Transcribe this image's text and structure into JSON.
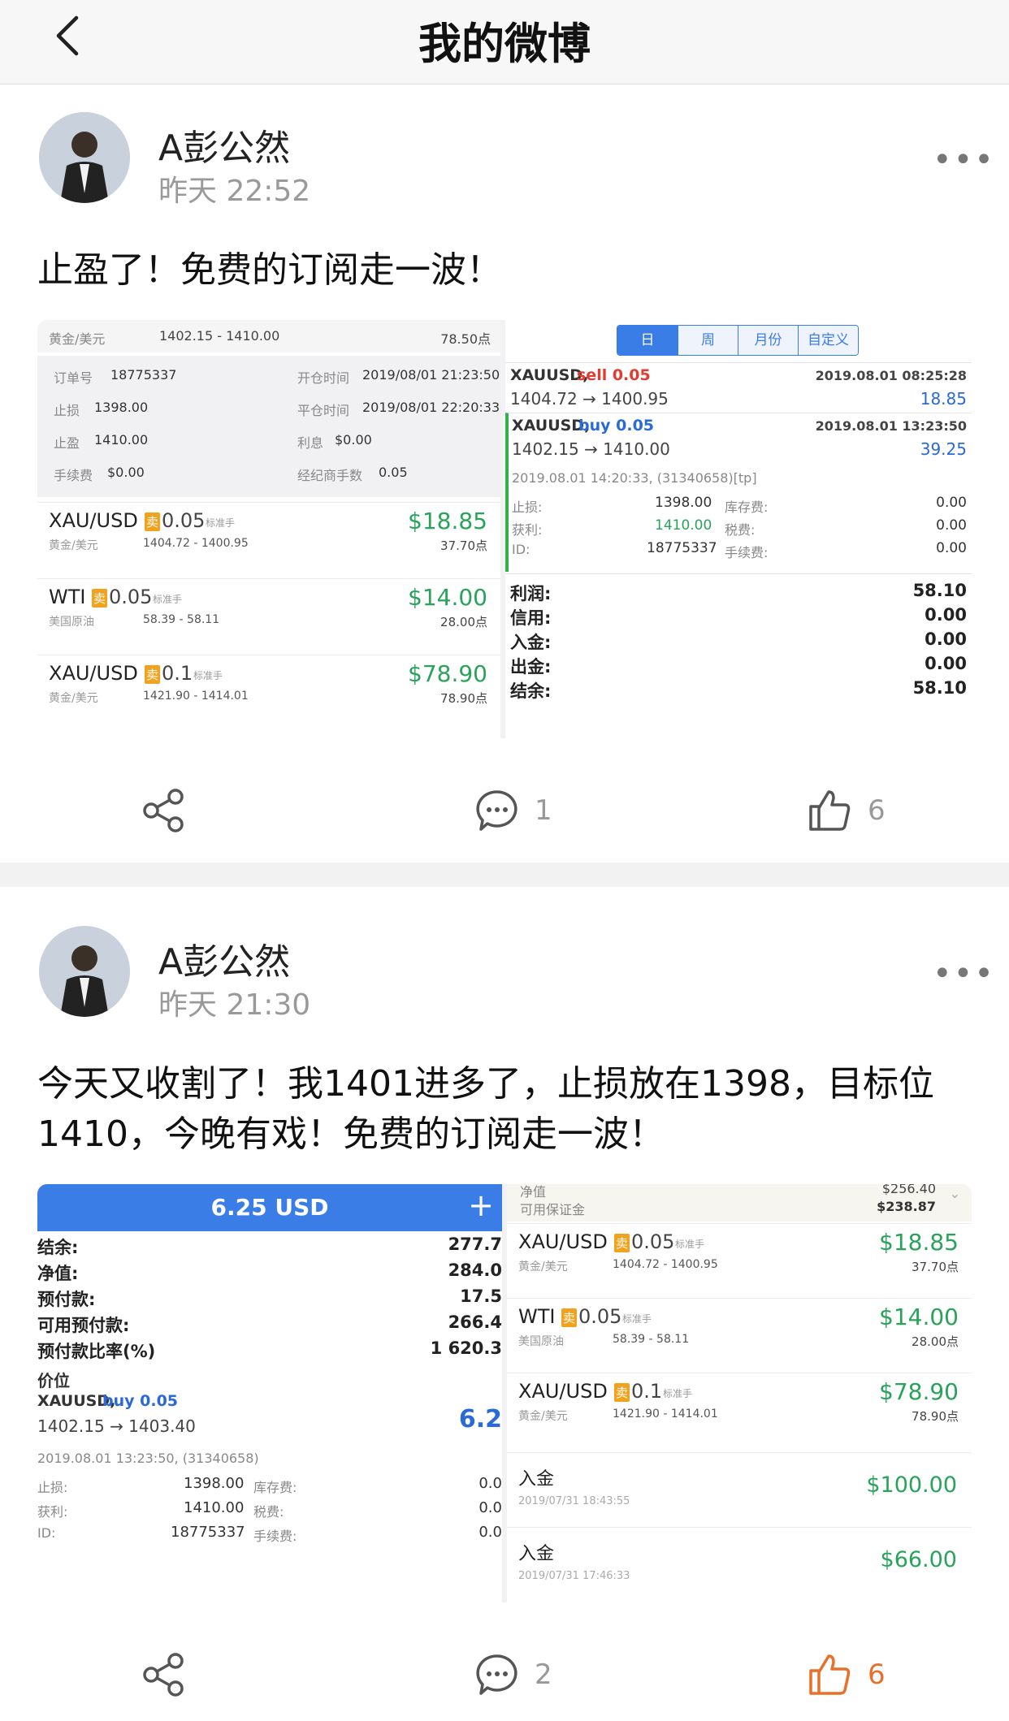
{
  "header": {
    "title": "我的微博"
  },
  "posts": [
    {
      "author": "A彭公然",
      "time": "昨天 22:52",
      "text": "止盈了！免费的订阅走一波！",
      "comments": "1",
      "likes": "6",
      "left": {
        "top_pair": "黄金/美元",
        "top_range": "1402.15 - 1410.00",
        "top_points": "78.50点",
        "order_no_label": "订单号",
        "order_no": "18775337",
        "open_label": "开仓时间",
        "open_time": "2019/08/01 21:23:50",
        "sl_label": "止损",
        "sl": "1398.00",
        "close_label": "平仓时间",
        "close_time": "2019/08/01 22:20:33",
        "tp_label": "止盈",
        "tp": "1410.00",
        "interest_label": "利息",
        "interest": "$0.00",
        "fee_label": "手续费",
        "fee": "$0.00",
        "broker_label": "经纪商手数",
        "broker": "0.05",
        "trades": [
          {
            "sym": "XAU/USD",
            "badge": "卖",
            "lot": "0.05",
            "tag": "标准手",
            "pair": "黄金/美元",
            "range": "1404.72 - 1400.95",
            "profit": "$18.85",
            "points": "37.70点"
          },
          {
            "sym": "WTI",
            "badge": "卖",
            "lot": "0.05",
            "tag": "标准手",
            "pair": "美国原油",
            "range": "58.39 - 58.11",
            "profit": "$14.00",
            "points": "28.00点"
          },
          {
            "sym": "XAU/USD",
            "badge": "卖",
            "lot": "0.1",
            "tag": "标准手",
            "pair": "黄金/美元",
            "range": "1421.90 - 1414.01",
            "profit": "$78.90",
            "points": "78.90点"
          }
        ]
      },
      "right": {
        "tabs": [
          "日",
          "周",
          "月份",
          "自定义"
        ],
        "t1_sym": "XAUUSD,",
        "t1_side": "sell 0.05",
        "t1_date": "2019.08.01 08:25:28",
        "t1_range": "1404.72 → 1400.95",
        "t1_profit": "18.85",
        "t2_sym": "XAUUSD,",
        "t2_side": "buy 0.05",
        "t2_date": "2019.08.01 13:23:50",
        "t2_range": "1402.15 → 1410.00",
        "t2_profit": "39.25",
        "t2_meta": "2019.08.01 14:20:33, (31340658)[tp]",
        "d_sl_label": "止损:",
        "d_sl": "1398.00",
        "d_swap_label": "库存费:",
        "d_swap": "0.00",
        "d_tp_label": "获利:",
        "d_tp": "1410.00",
        "d_tax_label": "税费:",
        "d_tax": "0.00",
        "d_id_label": "ID:",
        "d_id": "18775337",
        "d_fee_label": "手续费:",
        "d_fee": "0.00",
        "summary": [
          {
            "label": "利润:",
            "value": "58.10"
          },
          {
            "label": "信用:",
            "value": "0.00"
          },
          {
            "label": "入金:",
            "value": "0.00"
          },
          {
            "label": "出金:",
            "value": "0.00"
          },
          {
            "label": "结余:",
            "value": "58.10"
          }
        ]
      }
    },
    {
      "author": "A彭公然",
      "time": "昨天 21:30",
      "text": "今天又收割了！我1401进多了，止损放在1398，目标位1410，今晚有戏！免费的订阅走一波！",
      "comments": "2",
      "likes": "6",
      "left": {
        "bar_title": "6.25 USD",
        "bar_plus": "+",
        "rows": [
          {
            "label": "结余:",
            "value": "277.7"
          },
          {
            "label": "净值:",
            "value": "284.0"
          },
          {
            "label": "预付款:",
            "value": "17.5"
          },
          {
            "label": "可用预付款:",
            "value": "266.4"
          },
          {
            "label": "预付款比率(%)",
            "value": "1 620.3"
          }
        ],
        "section": "价位",
        "p_sym": "XAUUSD,",
        "p_side": "buy 0.05",
        "p_range": "1402.15 → 1403.40",
        "p_profit": "6.2",
        "p_meta": "2019.08.01 13:23:50, (31340658)",
        "d_sl_label": "止损:",
        "d_sl": "1398.00",
        "d_swap_label": "库存费:",
        "d_swap": "0.0",
        "d_tp_label": "获利:",
        "d_tp": "1410.00",
        "d_tax_label": "税费:",
        "d_tax": "0.0",
        "d_id_label": "ID:",
        "d_id": "18775337",
        "d_fee_label": "手续费:",
        "d_fee": "0.0"
      },
      "right": {
        "top_l1": "净值",
        "top_r1": "$256.40",
        "top_l2": "可用保证金",
        "top_r2": "$238.87",
        "trades": [
          {
            "sym": "XAU/USD",
            "badge": "卖",
            "lot": "0.05",
            "tag": "标准手",
            "pair": "黄金/美元",
            "range": "1404.72 - 1400.95",
            "profit": "$18.85",
            "points": "37.70点"
          },
          {
            "sym": "WTI",
            "badge": "卖",
            "lot": "0.05",
            "tag": "标准手",
            "pair": "美国原油",
            "range": "58.39 - 58.11",
            "profit": "$14.00",
            "points": "28.00点"
          },
          {
            "sym": "XAU/USD",
            "badge": "卖",
            "lot": "0.1",
            "tag": "标准手",
            "pair": "黄金/美元",
            "range": "1421.90 - 1414.01",
            "profit": "$78.90",
            "points": "78.90点"
          }
        ],
        "deposits": [
          {
            "label": "入金",
            "date": "2019/07/31 18:43:55",
            "amount": "$100.00"
          },
          {
            "label": "入金",
            "date": "2019/07/31 17:46:33",
            "amount": "$66.00"
          }
        ]
      }
    }
  ],
  "colors": {
    "profit_green": "#29a35a",
    "like_active": "#e8702a",
    "blue_tab": "#3b7de6"
  }
}
